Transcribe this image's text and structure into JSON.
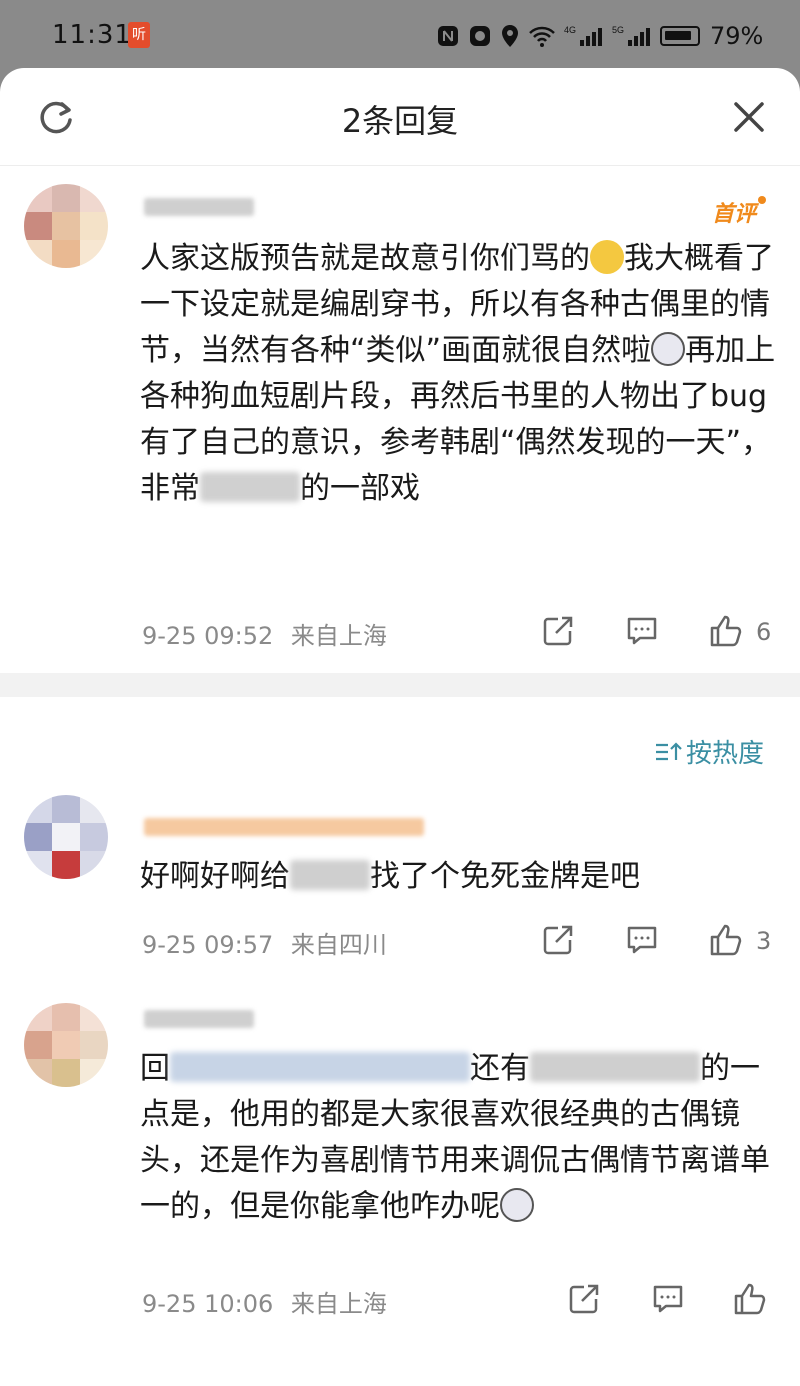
{
  "status_bar": {
    "time": "11:31",
    "app_badge": "听",
    "battery_pct": "79%"
  },
  "header": {
    "title": "2条回复"
  },
  "main_comment": {
    "badge": "首评",
    "text_before_emoji": "人家这版预告就是故意引你们骂的",
    "text_after_emoji1": "我大概看了一下设定就是编剧穿书，所以有各种古偶里的情节，当然有各种“类似”画面就很自然啦",
    "text_after_emoji2": "再加上各种狗血短剧片段，再然后书里的人物出了bug有了自己的意识，参考韩剧“偶然发现的一天”，非常",
    "text_end": "的一部戏",
    "time": "9-25 09:52",
    "location": "来自上海",
    "likes": "6"
  },
  "sort": {
    "label": "按热度"
  },
  "reply1": {
    "text_start": "好啊好啊给",
    "text_end": "找了个免死金牌是吧",
    "time": "9-25 09:57",
    "location": "来自四川",
    "likes": "3"
  },
  "reply2": {
    "text_start": "回",
    "text_mid": "还有",
    "text_after_mid": "的一点是，他用的都是大家很喜欢很经典的古偶镜头，还是作为喜剧情节用来调侃古偶情节离谱单一的，但是你能拿他咋办呢",
    "time": "9-25 10:06",
    "location": "来自上海"
  },
  "colors": {
    "accent_badge": "#f08a1c",
    "sort_color": "#3b8fa3",
    "meta_gray": "#8a8a8a"
  }
}
